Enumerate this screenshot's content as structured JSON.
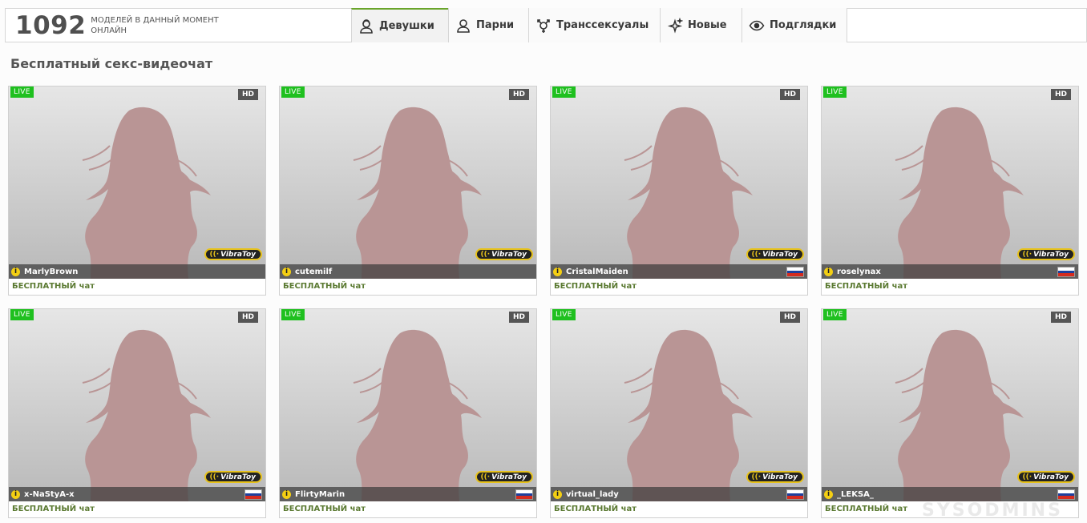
{
  "header": {
    "online_count": "1092",
    "online_label": "МОДЕЛЕЙ В ДАННЫЙ МОМЕНТ ОНЛАЙН"
  },
  "tabs": [
    {
      "label": "Девушки",
      "icon": "female-user-icon"
    },
    {
      "label": "Парни",
      "icon": "male-user-icon"
    },
    {
      "label": "Транссексуалы",
      "icon": "transgender-icon"
    },
    {
      "label": "Новые",
      "icon": "sparkle-icon"
    },
    {
      "label": "Подглядки",
      "icon": "eye-icon"
    }
  ],
  "main": {
    "heading": "Бесплатный секс-видеочат"
  },
  "badges": {
    "live": "LIVE",
    "hd": "HD",
    "vibratoy": "VibraToy",
    "info": "i"
  },
  "models": [
    {
      "name": "MarlyBrown",
      "flag": "",
      "chat_type": "БЕСПЛАТНЫЙ чат"
    },
    {
      "name": "cutemilf",
      "flag": "",
      "chat_type": "БЕСПЛАТНЫЙ чат"
    },
    {
      "name": "CristalMaiden",
      "flag": "ru",
      "chat_type": "БЕСПЛАТНЫЙ чат"
    },
    {
      "name": "roselynax",
      "flag": "ru",
      "chat_type": "БЕСПЛАТНЫЙ чат"
    },
    {
      "name": "x-NaStyA-x",
      "flag": "ru",
      "chat_type": "БЕСПЛАТНЫЙ чат"
    },
    {
      "name": "FlirtyMarin",
      "flag": "ru",
      "chat_type": "БЕСПЛАТНЫЙ чат"
    },
    {
      "name": "virtual_lady",
      "flag": "ru",
      "chat_type": "БЕСПЛАТНЫЙ чат"
    },
    {
      "name": "_LEKSA_",
      "flag": "ru",
      "chat_type": "БЕСПЛАТНЫЙ чат"
    }
  ],
  "watermark": "SYSODMINS",
  "colors": {
    "accent": "#6aa52b",
    "live": "#1fc01f",
    "silhouette": "#b99595",
    "vibra_border": "#e7c21b"
  }
}
